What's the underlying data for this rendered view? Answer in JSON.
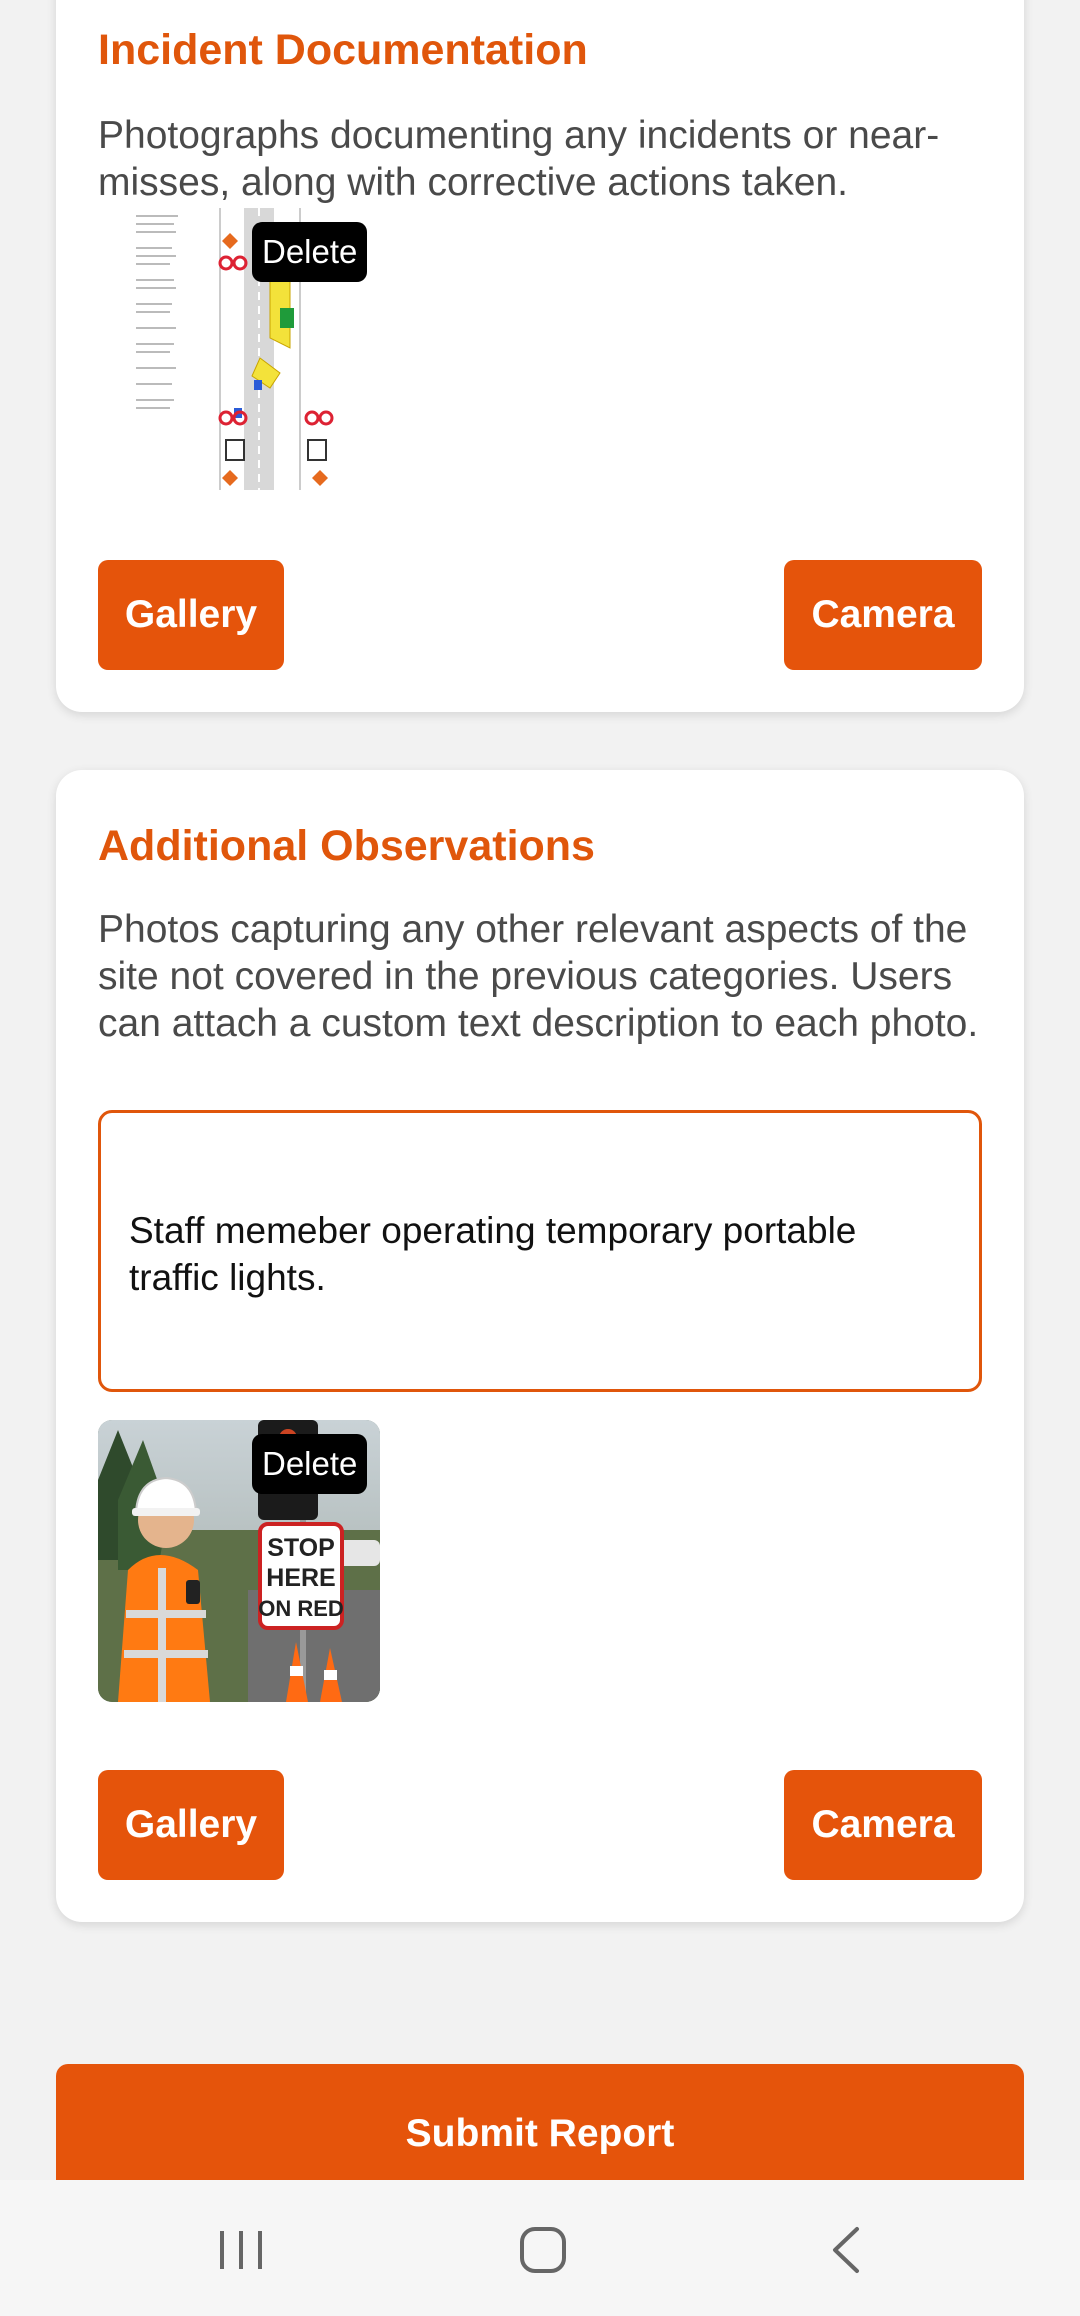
{
  "incident": {
    "title": "Incident Documentation",
    "description": "Photographs documenting any incidents or near-misses, along with corrective actions taken.",
    "photo_delete_label": "Delete",
    "gallery_label": "Gallery",
    "camera_label": "Camera"
  },
  "observations": {
    "title": "Additional Observations",
    "description": "Photos capturing any other relevant aspects of the site not covered in the previous categories. Users can attach a custom text description to each photo.",
    "photo_caption": "Staff memeber operating temporary portable traffic lights.",
    "photo_delete_label": "Delete",
    "photo_sign_text": [
      "STOP",
      "HERE",
      "ON RED"
    ],
    "gallery_label": "Gallery",
    "camera_label": "Camera"
  },
  "submit_label": "Submit Report",
  "nav": {
    "recent_icon": "recent-apps-icon",
    "home_icon": "home-icon",
    "back_icon": "back-icon"
  },
  "colors": {
    "accent": "#e5540b",
    "title": "#e0560b",
    "background": "#f2f2f2"
  }
}
